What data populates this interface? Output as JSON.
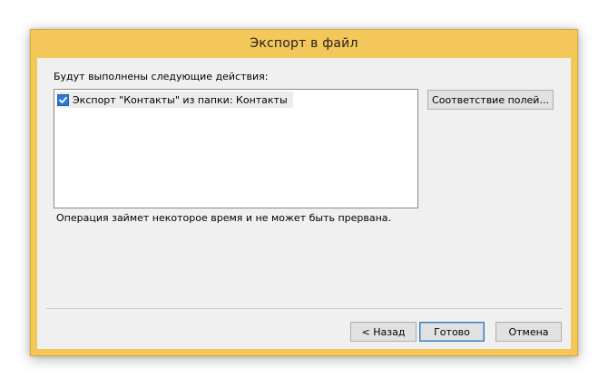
{
  "window": {
    "title": "Экспорт в файл",
    "accent_color": "#f4c75a"
  },
  "dialog": {
    "actions_label": "Будут выполнены следующие действия:",
    "items": [
      {
        "checked": true,
        "label": "Экспорт \"Контакты\" из папки: Контакты"
      }
    ],
    "info_text": "Операция займет некоторое время и не может быть прервана."
  },
  "buttons": {
    "map_fields": "Соответствие полей...",
    "back": "< Назад",
    "finish": "Готово",
    "cancel": "Отмена"
  }
}
